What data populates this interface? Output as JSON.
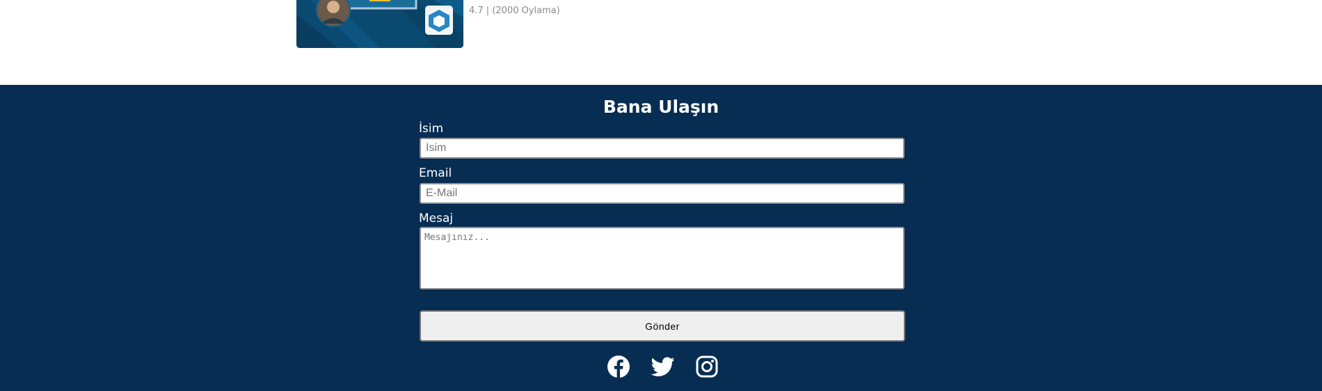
{
  "course": {
    "rating_text": "4.7 | (2000 Oylama)"
  },
  "contact": {
    "title": "Bana Ulaşın",
    "name_label": "İsim",
    "name_placeholder": "İsim",
    "email_label": "Email",
    "email_placeholder": "E-Mail",
    "message_label": "Mesaj",
    "message_placeholder": "Mesajınız...",
    "submit_label": "Gönder"
  },
  "social": {
    "icons": [
      "facebook-icon",
      "twitter-icon",
      "instagram-icon"
    ]
  },
  "colors": {
    "footer_bg": "#072d52",
    "footer_text": "#ffffff",
    "button_bg": "#efefef"
  }
}
